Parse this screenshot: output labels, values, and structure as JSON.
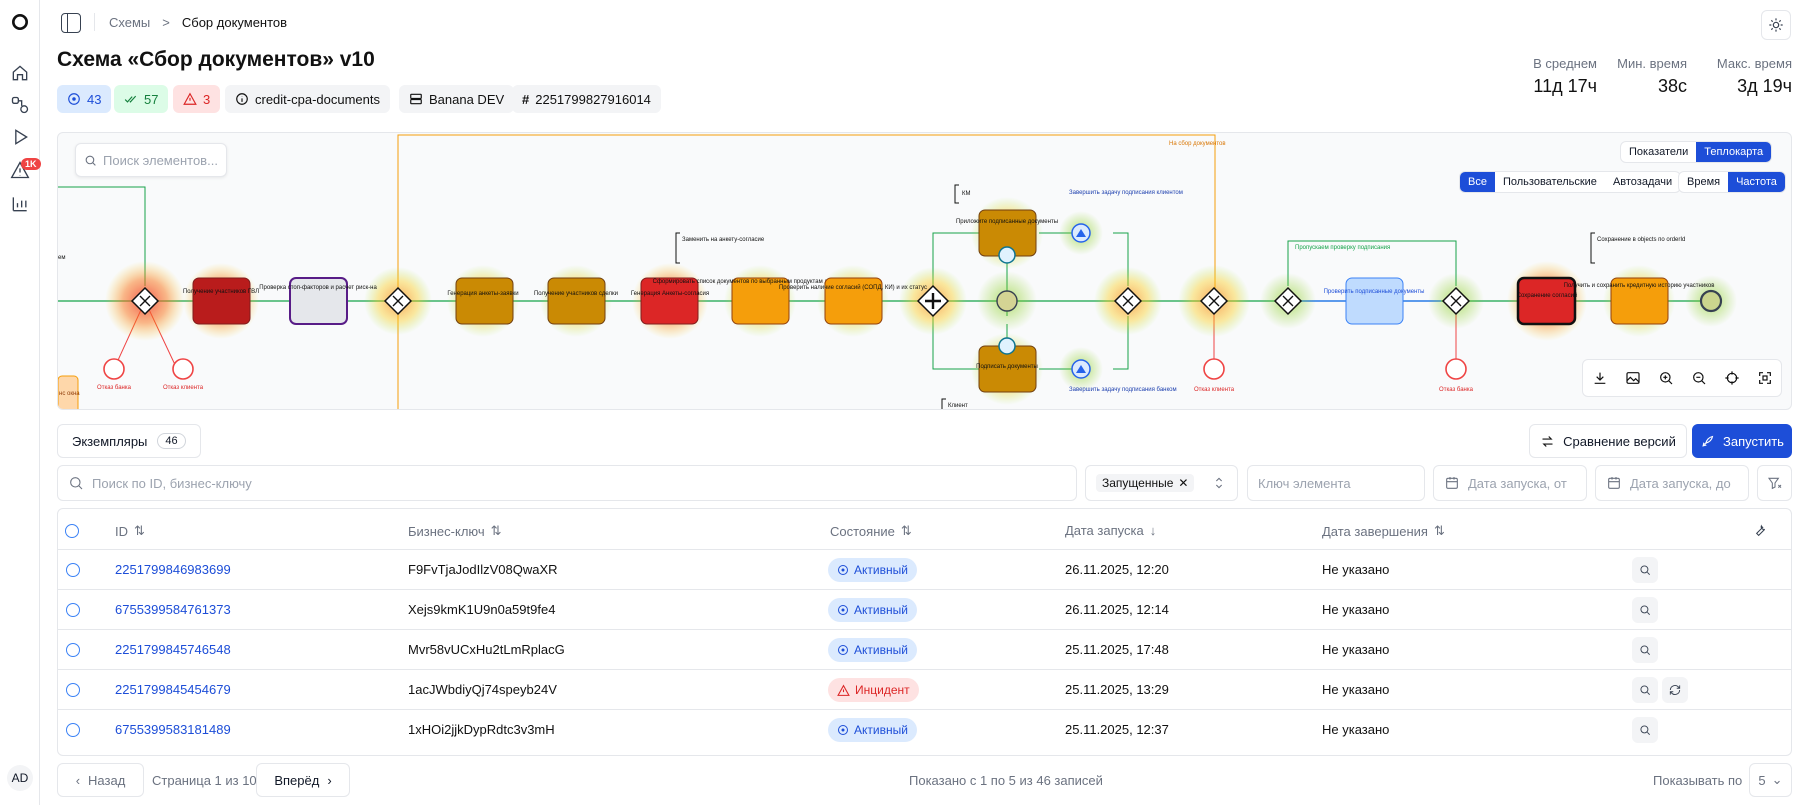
{
  "nav": {
    "alerts_badge": "1K",
    "avatar": "AD"
  },
  "breadcrumb": {
    "root": "Схемы",
    "separator": ">",
    "current": "Сбор документов"
  },
  "page_title": "Схема «Сбор документов» v10",
  "chips": {
    "active": "43",
    "completed": "57",
    "incidents": "3",
    "process_key": "credit-cpa-documents",
    "environment": "Banana DEV",
    "definition_id": "2251799827916014"
  },
  "stats": [
    {
      "label": "В среднем",
      "value": "11д 17ч"
    },
    {
      "label": "Мин. время",
      "value": "38с"
    },
    {
      "label": "Макс. время",
      "value": "3д 19ч"
    }
  ],
  "diagram": {
    "search_placeholder": "Поиск элементов...",
    "view_toggle": [
      "Показатели",
      "Теплокарта"
    ],
    "view_selected": "Теплокарта",
    "filter_toggle": [
      "Все",
      "Пользовательские",
      "Автозадачи"
    ],
    "filter_selected": "Все",
    "metric_toggle": [
      "Время",
      "Частота"
    ],
    "metric_selected": "Частота",
    "texts": {
      "n_to_collect": "На сбор документов",
      "t_vyi": "Получение участников ГВЛ",
      "t_check": "Проверка стоп-факторов и расчет риск-на",
      "t_gen_app": "Генерация анкеты-заявки",
      "t_get_members": "Получение участников сделки",
      "t_gen_consent": "Генерация Анкеты-согласия",
      "t_form_list": "Сформировать список документов по выбранным продуктам для участников",
      "t_check_consent": "Проверить наличие согласий (СОПД, КИ) и их статус",
      "t_attach": "Приложите подписанные документы",
      "t_sign": "Подписать документы",
      "t_check_signed": "Проверить подписанные документы",
      "t_save_consent": "Сохранение согласий",
      "t_get_history": "Получить и сохранить кредитную историю участников",
      "ann_replace": "Заменить на анкету-согласие",
      "ann_km": "КМ",
      "ann_client": "Клиент",
      "ann_skip": "Пропускаем проверку подписания",
      "ann_save_orderid": "Сохранение в objects по orderId",
      "ev_finish_task": "Завершить задачу подписания клиентом",
      "ev_finish_task2": "Завершить задачу подписания банком",
      "err_bank": "Отказ банка",
      "err_client": "Отказ клиента",
      "ann_left": "ем",
      "box_left": "нс окна"
    }
  },
  "instances_tab": {
    "label": "Экземпляры",
    "count": "46"
  },
  "actions": {
    "compare": "Сравнение версий",
    "run": "Запустить"
  },
  "filters": {
    "search_placeholder": "Поиск по ID, бизнес-ключу",
    "state_tag": "Запущенные",
    "element_key_placeholder": "Ключ элемента",
    "date_from_placeholder": "Дата запуска, от",
    "date_to_placeholder": "Дата запуска, до"
  },
  "table": {
    "headers": {
      "id": "ID",
      "business_key": "Бизнес-ключ",
      "state": "Состояние",
      "start": "Дата запуска",
      "end": "Дата завершения"
    },
    "rows": [
      {
        "id": "2251799846983699",
        "key": "F9FvTjaJodIlzV08QwaXR",
        "state": "Активный",
        "state_type": "active",
        "start": "26.11.2025, 12:20",
        "end": "Не указано",
        "retry": false
      },
      {
        "id": "6755399584761373",
        "key": "Xejs9kmK1U9n0a59t9fe4",
        "state": "Активный",
        "state_type": "active",
        "start": "26.11.2025, 12:14",
        "end": "Не указано",
        "retry": false
      },
      {
        "id": "2251799845746548",
        "key": "Mvr58vUCxHu2tLmRplacG",
        "state": "Активный",
        "state_type": "active",
        "start": "25.11.2025, 17:48",
        "end": "Не указано",
        "retry": false
      },
      {
        "id": "2251799845454679",
        "key": "1acJWbdiyQj74speyb24V",
        "state": "Инцидент",
        "state_type": "incident",
        "start": "25.11.2025, 13:29",
        "end": "Не указано",
        "retry": true
      },
      {
        "id": "6755399583181489",
        "key": "1xHOi2jjkDypRdtc3v3mH",
        "state": "Активный",
        "state_type": "active",
        "start": "25.11.2025, 12:37",
        "end": "Не указано",
        "retry": false
      }
    ]
  },
  "pagination": {
    "prev": "Назад",
    "page_info": "Страница 1 из 10",
    "next": "Вперёд",
    "shown": "Показано с 1 по 5 из 46 записей",
    "per_page_label": "Показывать по",
    "per_page": "5"
  }
}
